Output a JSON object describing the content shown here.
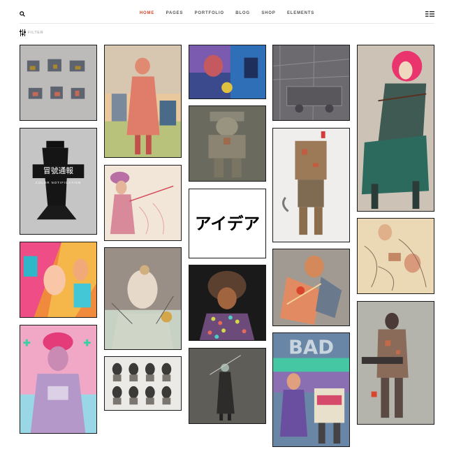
{
  "nav": {
    "items": [
      "HOME",
      "PAGES",
      "PORTFOLIO",
      "BLOG",
      "SHOP",
      "ELEMENTS"
    ],
    "active": "HOME",
    "search_icon": "search-icon",
    "menu_icon": "hamburger-menu-icon"
  },
  "filter": {
    "label": "FILTER",
    "icon": "filter-sliders-icon"
  },
  "colors": {
    "accent": "#d9452c",
    "text": "#555555",
    "border": "#1a1a1a"
  },
  "gallery": {
    "poster_title": "冒號通報",
    "poster_subtitle": "COLOR NOTIFICATION",
    "logo_text": "アイデア",
    "comic_text": "BAD"
  }
}
